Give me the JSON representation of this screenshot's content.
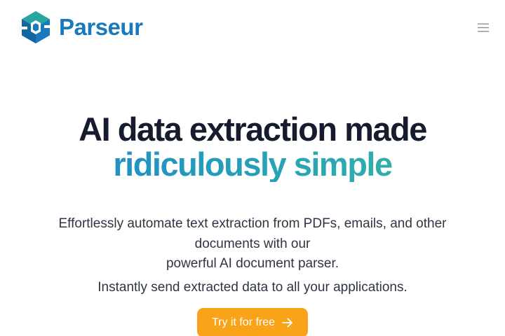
{
  "header": {
    "brand_name": "Parseur",
    "logo_icon": "parseur-cube-icon",
    "menu_icon": "hamburger-menu-icon"
  },
  "hero": {
    "headline_line1": "AI data extraction made",
    "headline_line2": "ridiculously simple",
    "description_line1": "Effortlessly automate text extraction from PDFs, emails, and other documents with our",
    "description_line2": "powerful AI document parser.",
    "subline": "Instantly send extracted data to all your applications.",
    "cta_label": "Try it for free",
    "cta_icon": "arrow-right-icon"
  },
  "colors": {
    "brand_blue": "#1a79bd",
    "logo_teal": "#2aa6a0",
    "accent_gradient_start": "#1f86c8",
    "accent_gradient_end": "#3cba9e",
    "cta_orange": "#f8a318",
    "heading": "#161c2d",
    "body_text": "#2f3542"
  }
}
